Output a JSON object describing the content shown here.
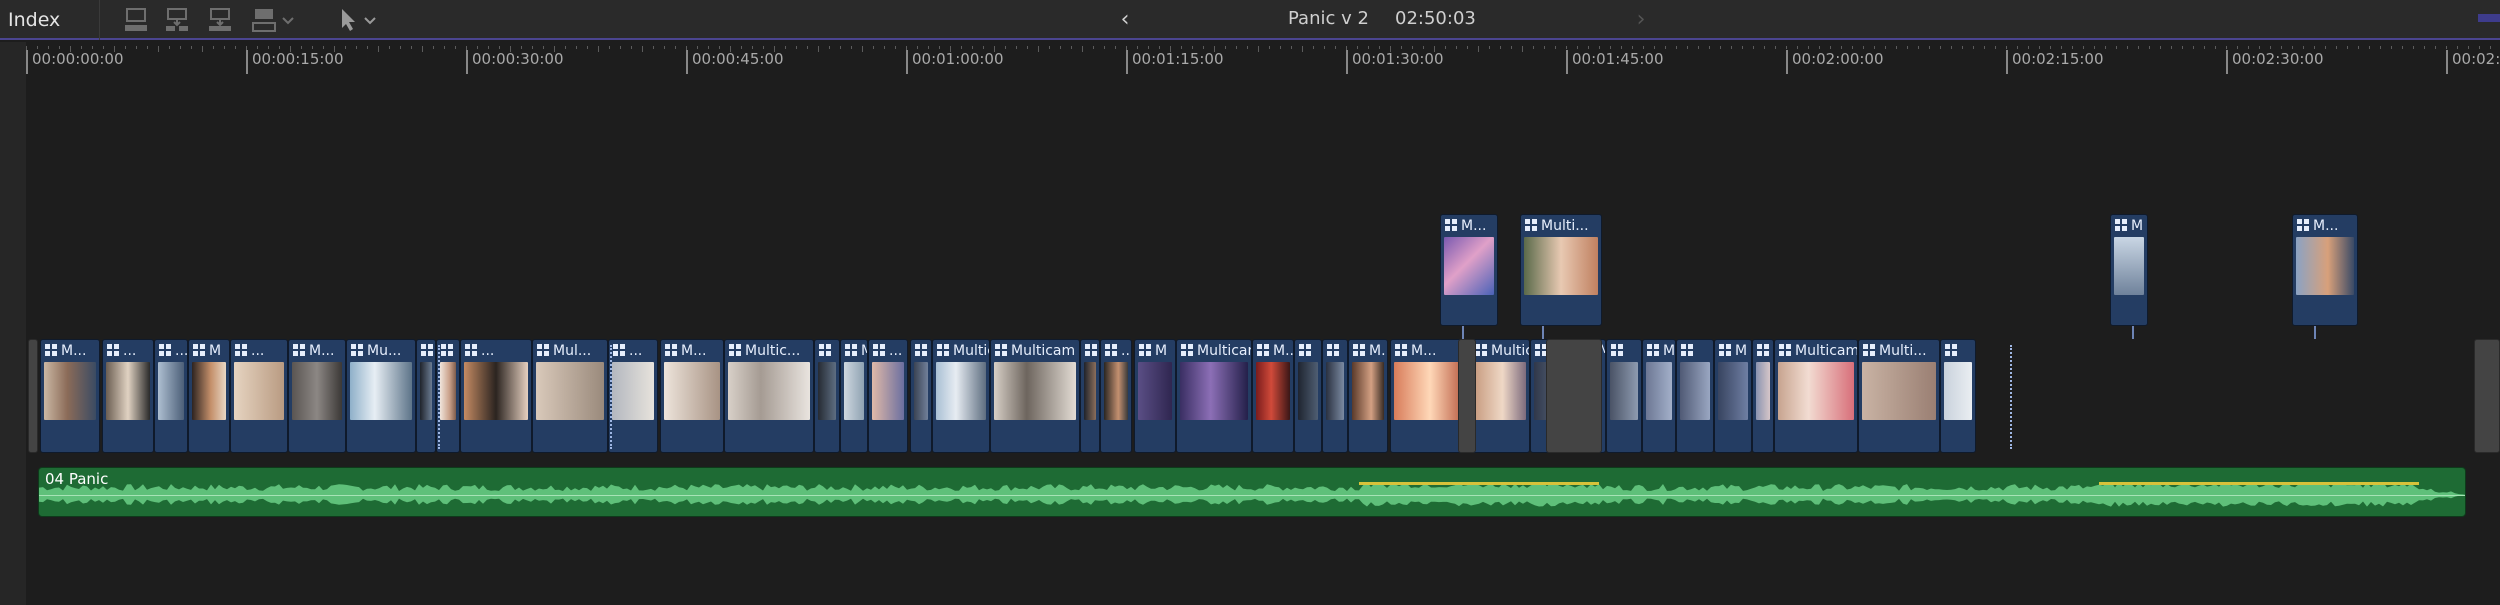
{
  "toolbar": {
    "index_label": "Index",
    "project_name": "Panic v 2",
    "project_duration": "02:50:03",
    "icons": [
      "append-clip-icon",
      "insert-clip-icon",
      "overwrite-clip-icon",
      "connect-clip-icon",
      "select-tool-icon",
      "chevron-down-icon",
      "back-arrow-icon",
      "forward-arrow-icon"
    ],
    "back_glyph": "‹",
    "forward_glyph": "›",
    "accent_color": "#4b4590"
  },
  "ruler": {
    "labels": [
      "00:00:00:00",
      "00:00:15:00",
      "00:00:30:00",
      "00:00:45:00",
      "00:01:00:00",
      "00:01:15:00",
      "00:01:30:00",
      "00:01:45:00",
      "00:02:00:00",
      "00:02:15:00",
      "00:02:30:00",
      "00:02:"
    ]
  },
  "primary_storyline": {
    "clip_color": "#243d63",
    "clips": [
      {
        "label": "M..."
      },
      {
        "label": "..."
      },
      {
        "label": "..."
      },
      {
        "label": "M"
      },
      {
        "label": "..."
      },
      {
        "label": "M..."
      },
      {
        "label": "Mu..."
      },
      {
        "label": ""
      },
      {
        "label": ""
      },
      {
        "label": "..."
      },
      {
        "label": "Mul..."
      },
      {
        "label": "..."
      },
      {
        "label": "M..."
      },
      {
        "label": "Multic..."
      },
      {
        "label": ""
      },
      {
        "label": "M"
      },
      {
        "label": "..."
      },
      {
        "label": ""
      },
      {
        "label": "Multic..."
      },
      {
        "label": "Multicam"
      },
      {
        "label": ""
      },
      {
        "label": "..."
      },
      {
        "label": "M"
      },
      {
        "label": "Multicam"
      },
      {
        "label": "M..."
      },
      {
        "label": ""
      },
      {
        "label": ""
      },
      {
        "label": "M..."
      },
      {
        "label": "M..."
      },
      {
        "label": "Multicam"
      },
      {
        "label": ""
      },
      {
        "label": "M..."
      },
      {
        "label": ""
      },
      {
        "label": "M"
      },
      {
        "label": ""
      },
      {
        "label": "M"
      },
      {
        "label": ""
      },
      {
        "label": "Multicam"
      },
      {
        "label": "Multi..."
      },
      {
        "label": ""
      }
    ]
  },
  "connected_clips": [
    {
      "label": "M..."
    },
    {
      "label": "Multi..."
    },
    {
      "label": "M"
    },
    {
      "label": "M..."
    }
  ],
  "audio": {
    "label": "04 Panic",
    "color": "#1e6b34",
    "wave_color": "#5fc07a",
    "peak_color": "#d7c23a"
  }
}
